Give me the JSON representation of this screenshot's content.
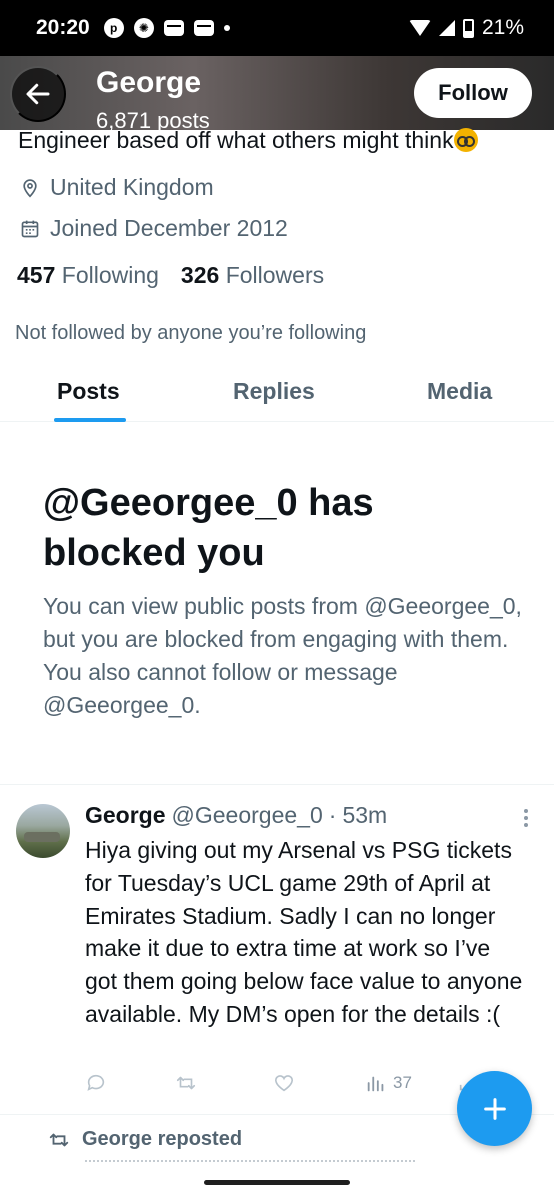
{
  "status_bar": {
    "time": "20:20",
    "battery": "21%"
  },
  "header": {
    "name": "George",
    "posts": "6,871 posts",
    "follow_label": "Follow"
  },
  "profile": {
    "bio": "Engineer based off what others might think",
    "location": "United Kingdom",
    "joined": "Joined December 2012",
    "following_count": "457",
    "following_label": "Following",
    "followers_count": "326",
    "followers_label": "Followers",
    "not_followed_text": "Not followed by anyone you’re following"
  },
  "tabs": [
    {
      "label": "Posts",
      "active": true
    },
    {
      "label": "Replies",
      "active": false
    },
    {
      "label": "Media",
      "active": false
    }
  ],
  "blocked": {
    "title": "@Geeorgee_0 has blocked you",
    "message": "You can view public posts from @Geeorgee_0, but you are blocked from engaging with them. You also cannot follow or message @Geeorgee_0."
  },
  "tweet": {
    "name": "George",
    "handle": "@Geeorgee_0",
    "separator": "·",
    "time": "53m",
    "body": "Hiya giving out my Arsenal vs PSG tickets for Tuesday’s UCL game 29th of April at Emirates Stadium. Sadly I can no longer make it due to extra time at work so I’ve got them going below face value to anyone available. My DM’s open for the details :(",
    "views": "37"
  },
  "repost": {
    "label": "George reposted"
  },
  "colors": {
    "accent": "#1d9bf0",
    "text": "#0f1419",
    "secondary": "#536471"
  }
}
